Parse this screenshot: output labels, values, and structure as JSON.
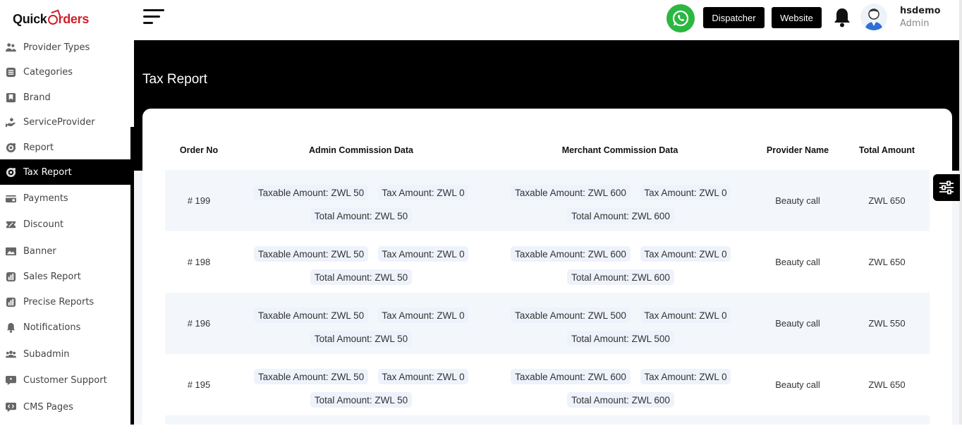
{
  "logo": {
    "part1": "Quick",
    "part2": "rders"
  },
  "sidebar": {
    "items": [
      {
        "label": "Provider Types",
        "icon": "users-icon"
      },
      {
        "label": "Categories",
        "icon": "list-icon"
      },
      {
        "label": "Brand",
        "icon": "bookmark-icon"
      },
      {
        "label": "ServiceProvider",
        "icon": "hand-service-icon"
      },
      {
        "label": "Report",
        "icon": "report-icon"
      },
      {
        "label": "Tax Report",
        "icon": "tax-report-icon",
        "active": true
      },
      {
        "label": "Payments",
        "icon": "wallet-icon"
      },
      {
        "label": "Discount",
        "icon": "ticket-icon"
      },
      {
        "label": "Banner",
        "icon": "image-icon"
      },
      {
        "label": "Sales Report",
        "icon": "chart-icon"
      },
      {
        "label": "Precise Reports",
        "icon": "chart-icon"
      },
      {
        "label": "Notifications",
        "icon": "bell-icon"
      },
      {
        "label": "Subadmin",
        "icon": "group-icon"
      },
      {
        "label": "Customer Support",
        "icon": "chat-icon"
      },
      {
        "label": "CMS Pages",
        "icon": "code-chat-icon"
      }
    ]
  },
  "header": {
    "dispatcher_label": "Dispatcher",
    "website_label": "Website",
    "user_name": "hsdemo",
    "user_role": "Admin"
  },
  "page": {
    "title": "Tax Report"
  },
  "table": {
    "headers": {
      "order_no": "Order No",
      "admin": "Admin Commission Data",
      "merchant": "Merchant Commission Data",
      "provider": "Provider Name",
      "total": "Total Amount"
    },
    "rows": [
      {
        "order": "# 199",
        "admin_taxable": "Taxable Amount: ZWL 50",
        "admin_tax": "Tax Amount: ZWL 0",
        "admin_total": "Total Amount: ZWL 50",
        "merchant_taxable": "Taxable Amount: ZWL 600",
        "merchant_tax": "Tax Amount: ZWL 0",
        "merchant_total": "Total Amount: ZWL 600",
        "provider": "Beauty call",
        "total": "ZWL 650"
      },
      {
        "order": "# 198",
        "admin_taxable": "Taxable Amount: ZWL 50",
        "admin_tax": "Tax Amount: ZWL 0",
        "admin_total": "Total Amount: ZWL 50",
        "merchant_taxable": "Taxable Amount: ZWL 600",
        "merchant_tax": "Tax Amount: ZWL 0",
        "merchant_total": "Total Amount: ZWL 600",
        "provider": "Beauty call",
        "total": "ZWL 650"
      },
      {
        "order": "# 196",
        "admin_taxable": "Taxable Amount: ZWL 50",
        "admin_tax": "Tax Amount: ZWL 0",
        "admin_total": "Total Amount: ZWL 50",
        "merchant_taxable": "Taxable Amount: ZWL 500",
        "merchant_tax": "Tax Amount: ZWL 0",
        "merchant_total": "Total Amount: ZWL 500",
        "provider": "Beauty call",
        "total": "ZWL 550"
      },
      {
        "order": "# 195",
        "admin_taxable": "Taxable Amount: ZWL 50",
        "admin_tax": "Tax Amount: ZWL 0",
        "admin_total": "Total Amount: ZWL 50",
        "merchant_taxable": "Taxable Amount: ZWL 600",
        "merchant_tax": "Tax Amount: ZWL 0",
        "merchant_total": "Total Amount: ZWL 600",
        "provider": "Beauty call",
        "total": "ZWL 650"
      }
    ]
  },
  "colors": {
    "accent": "#000000",
    "brand_red": "#d0202a",
    "whatsapp": "#2bb741",
    "row_alt": "#f3f7fc"
  }
}
